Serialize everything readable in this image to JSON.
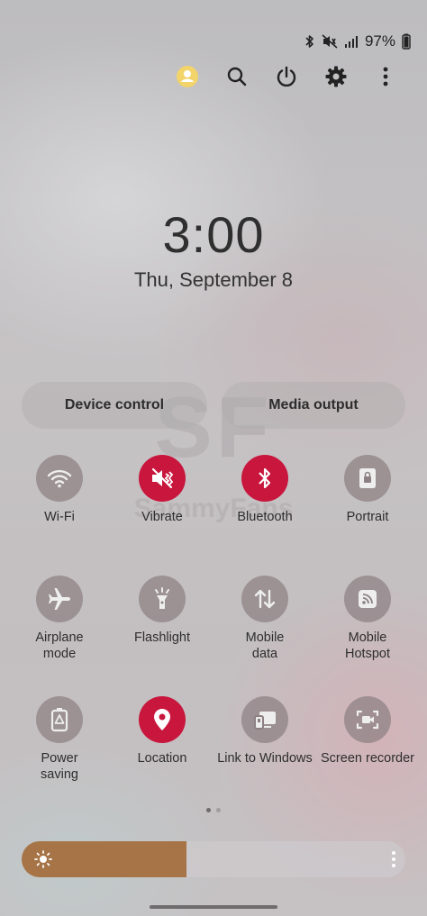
{
  "status_bar": {
    "battery": "97%",
    "icons": [
      "bluetooth-icon",
      "vibrate-icon",
      "signal-icon"
    ]
  },
  "top_actions": [
    "account-icon",
    "search-icon",
    "power-icon",
    "settings-icon",
    "more-options-icon"
  ],
  "clock": {
    "time": "3:00",
    "date": "Thu, September 8"
  },
  "shortcuts": {
    "device_control": "Device control",
    "media_output": "Media output"
  },
  "watermark": {
    "logo": "SF",
    "text": "SammyFans"
  },
  "quick_settings": [
    {
      "label": "Wi-Fi",
      "icon": "wifi-icon",
      "active": false
    },
    {
      "label": "Vibrate",
      "icon": "vibrate-icon",
      "active": true
    },
    {
      "label": "Bluetooth",
      "icon": "bluetooth-icon",
      "active": true
    },
    {
      "label": "Portrait",
      "icon": "portrait-lock-icon",
      "active": false
    },
    {
      "label": "Airplane\nmode",
      "icon": "airplane-icon",
      "active": false
    },
    {
      "label": "Flashlight",
      "icon": "flashlight-icon",
      "active": false
    },
    {
      "label": "Mobile\ndata",
      "icon": "mobile-data-icon",
      "active": false
    },
    {
      "label": "Mobile\nHotspot",
      "icon": "hotspot-icon",
      "active": false
    },
    {
      "label": "Power\nsaving",
      "icon": "power-saving-icon",
      "active": false
    },
    {
      "label": "Location",
      "icon": "location-icon",
      "active": true
    },
    {
      "label": "Link to Windows",
      "icon": "link-to-windows-icon",
      "active": false
    },
    {
      "label": "Screen recorder",
      "icon": "screen-recorder-icon",
      "active": false
    }
  ],
  "pagination": {
    "current": 1,
    "total": 2
  },
  "brightness": {
    "level": 0.43
  },
  "colors": {
    "accent_active": "#c8163d",
    "brightness_fill": "#a77447",
    "account_yellow": "#f2d46a"
  }
}
